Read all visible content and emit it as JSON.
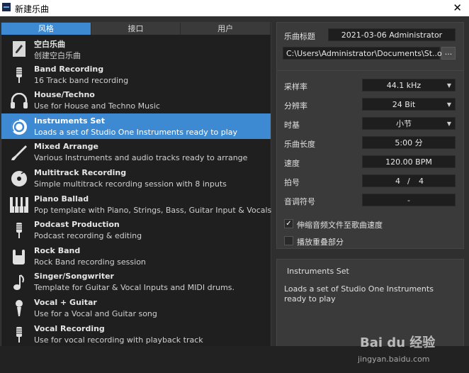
{
  "window": {
    "title": "新建乐曲",
    "close_glyph": "✕"
  },
  "tabs": [
    {
      "label": "风格",
      "active": true
    },
    {
      "label": "接口",
      "active": false
    },
    {
      "label": "用户",
      "active": false
    }
  ],
  "templates": [
    {
      "name": "空白乐曲",
      "desc": "创建空白乐曲",
      "icon": "blank-song-icon"
    },
    {
      "name": "Band Recording",
      "desc": "16 Track band recording",
      "icon": "microphone-icon"
    },
    {
      "name": "House/Techno",
      "desc": "Use for House and Techno Music",
      "icon": "headphones-icon"
    },
    {
      "name": "Instruments Set",
      "desc": "Loads a set of Studio One Instruments ready to play",
      "icon": "studio-one-icon",
      "selected": true
    },
    {
      "name": "Mixed Arrange",
      "desc": "Various Instruments and audio tracks ready to arrange",
      "icon": "brush-icon"
    },
    {
      "name": "Multitrack Recording",
      "desc": "Simple multitrack recording session with 8 inputs",
      "icon": "record-disc-icon"
    },
    {
      "name": "Piano Ballad",
      "desc": "Pop template with Piano, Strings, Bass, Guitar Input & Vocals",
      "icon": "piano-keys-icon"
    },
    {
      "name": "Podcast Production",
      "desc": "Podcast recording & editing",
      "icon": "microphone-icon"
    },
    {
      "name": "Rock Band",
      "desc": "Rock Band recording session",
      "icon": "rock-hand-icon"
    },
    {
      "name": "Singer/Songwriter",
      "desc": "Template for Guitar & Vocal Inputs and MIDI drums.",
      "icon": "music-note-icon"
    },
    {
      "name": "Vocal + Guitar",
      "desc": "Use for a Vocal and Guitar song",
      "icon": "handheld-mic-icon"
    },
    {
      "name": "Vocal Recording",
      "desc": "Use for vocal recording with playback track",
      "icon": "microphone-icon"
    }
  ],
  "song": {
    "title_label": "乐曲标题",
    "title_value": "2021-03-06 Administrator",
    "path_value": "C:\\Users\\Administrator\\Documents\\St..ongs",
    "browse_label": "..."
  },
  "settings": {
    "sample_rate_label": "采样率",
    "sample_rate_value": "44.1 kHz",
    "resolution_label": "分辨率",
    "resolution_value": "24 Bit",
    "timebase_label": "时基",
    "timebase_value": "小节",
    "length_label": "乐曲长度",
    "length_value": "5:00 分",
    "tempo_label": "速度",
    "tempo_value": "120.00 BPM",
    "signature_label": "拍号",
    "signature_num": "4",
    "signature_sep": "/",
    "signature_den": "4",
    "key_label": "音调符号",
    "key_value": "-",
    "stretch_label": "伸缩音频文件至歌曲速度",
    "stretch_checked": true,
    "check_glyph": "✓",
    "overlap_label": "播放重叠部分",
    "overlap_checked": false
  },
  "info": {
    "title": "Instruments Set",
    "description": "Loads a set of Studio One Instruments ready to play"
  },
  "watermark": {
    "brand": "Bai du 经验",
    "url": "jingyan.baidu.com"
  }
}
